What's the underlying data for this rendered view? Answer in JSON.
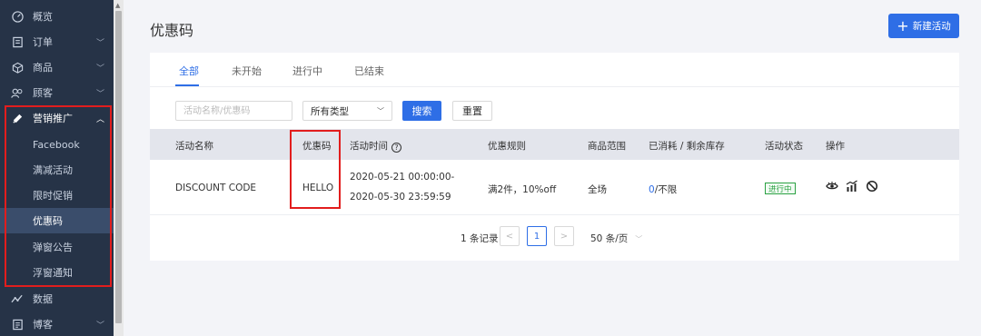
{
  "sidebar": {
    "items": [
      {
        "label": "概览",
        "icon": "overview-icon",
        "expandable": false
      },
      {
        "label": "订单",
        "icon": "order-icon",
        "expandable": true
      },
      {
        "label": "商品",
        "icon": "product-icon",
        "expandable": true
      },
      {
        "label": "顾客",
        "icon": "customer-icon",
        "expandable": true
      },
      {
        "label": "营销推广",
        "icon": "marketing-icon",
        "expandable": true,
        "open": true
      },
      {
        "label": "数据",
        "icon": "data-icon",
        "expandable": false
      },
      {
        "label": "博客",
        "icon": "blog-icon",
        "expandable": true
      }
    ],
    "submenu": [
      {
        "label": "Facebook"
      },
      {
        "label": "满减活动"
      },
      {
        "label": "限时促销"
      },
      {
        "label": "优惠码",
        "active": true
      },
      {
        "label": "弹窗公告"
      },
      {
        "label": "浮窗通知"
      }
    ]
  },
  "header": {
    "title": "优惠码",
    "create_button": "新建活动"
  },
  "tabs": [
    "全部",
    "未开始",
    "进行中",
    "已结束"
  ],
  "active_tab": "全部",
  "filters": {
    "search_placeholder": "活动名称/优惠码",
    "type_select": "所有类型",
    "search_button": "搜索",
    "reset_button": "重置"
  },
  "table": {
    "columns": [
      "活动名称",
      "优惠码",
      "活动时间",
      "优惠规则",
      "商品范围",
      "已消耗 / 剩余库存",
      "活动状态",
      "操作"
    ],
    "rows": [
      {
        "name": "DISCOUNT CODE",
        "code": "HELLO",
        "time_start": "2020-05-21 00:00:00-",
        "time_end": "2020-05-30 23:59:59",
        "rule": "满2件，10%off",
        "scope": "全场",
        "used": "0",
        "stock": "/不限",
        "status": "进行中",
        "actions": [
          "view-icon",
          "stats-icon",
          "disable-icon"
        ]
      }
    ]
  },
  "pagination": {
    "total": "1 条记录",
    "current_page": "1",
    "page_size": "50 条/页"
  },
  "colors": {
    "primary": "#2e6ee6",
    "sidebar_bg": "#263347",
    "highlight_border": "#e21d1d",
    "status_green": "#2aa142"
  }
}
